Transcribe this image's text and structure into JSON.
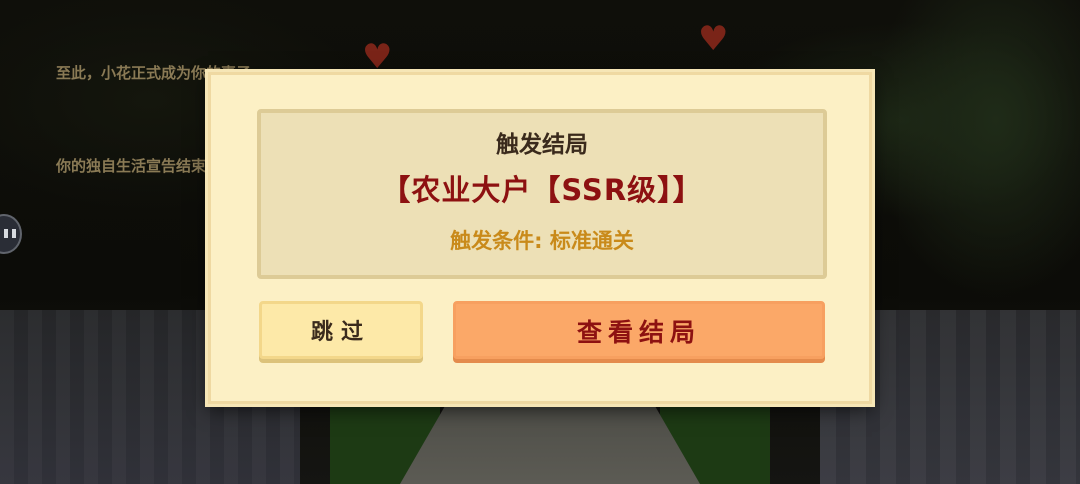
{
  "background": {
    "story_lines": [
      "至此，小花正式成为你的妻子",
      "你的独自生活宣告结束"
    ]
  },
  "dialog": {
    "title": "触发结局",
    "ending_name": "【农业大户【SSR级】】",
    "condition": "触发条件: 标准通关",
    "skip_label": "跳过",
    "view_label": "查看结局"
  },
  "colors": {
    "dialog_bg": "#fcf0c5",
    "panel_bg": "#ede0b6",
    "ending_name": "#8d1111",
    "condition": "#c98a1a",
    "skip_button": "#fde9a8",
    "view_button": "#fba868"
  },
  "icons": {
    "hearts": "heart-icon",
    "side": "chat-bubble-icon"
  }
}
